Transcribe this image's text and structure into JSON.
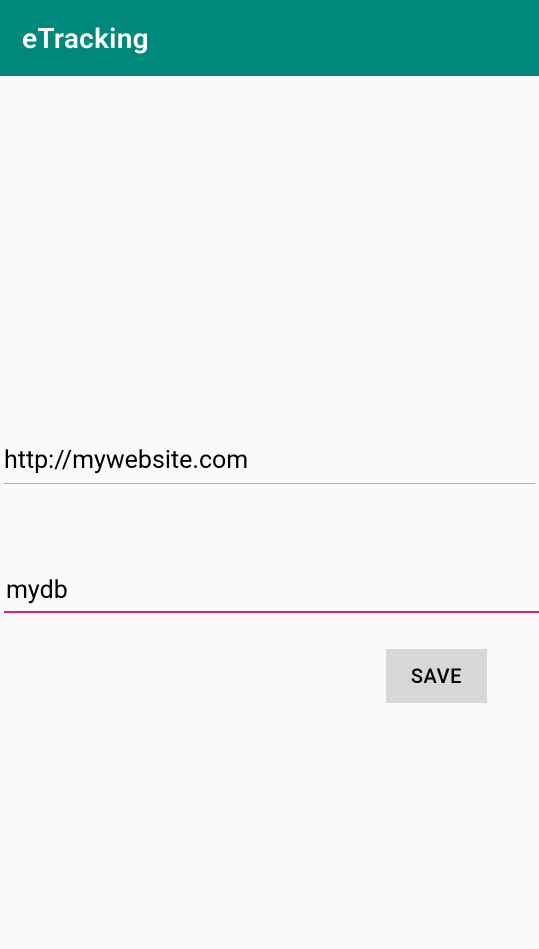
{
  "appBar": {
    "title": "eTracking"
  },
  "form": {
    "urlField": {
      "value": "http://mywebsite.com",
      "placeholder": ""
    },
    "dbField": {
      "value": "mydb",
      "placeholder": ""
    },
    "saveLabel": "SAVE"
  },
  "colors": {
    "primary": "#00897b",
    "accent": "#e91e63",
    "background": "#fafafa",
    "buttonBg": "#d6d7d7"
  }
}
